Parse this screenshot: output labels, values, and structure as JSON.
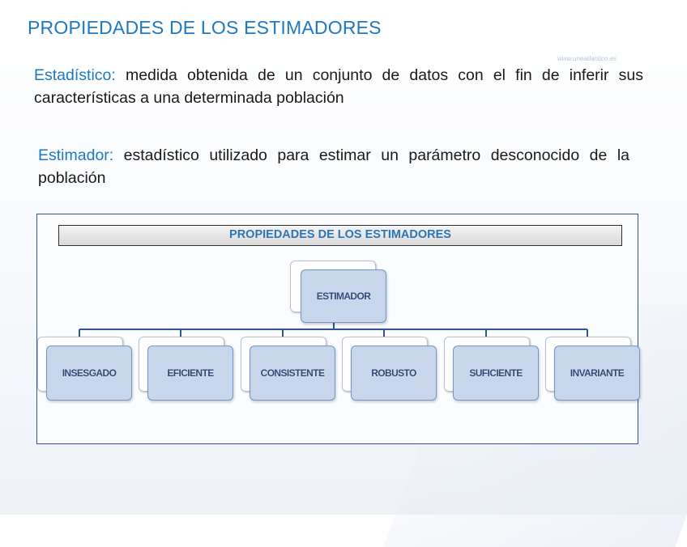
{
  "header": {
    "title": "PROPIEDADES DE LOS ESTIMADORES",
    "watermark": "www.uneatlantico.es"
  },
  "definitions": [
    {
      "term": "Estadístico:",
      "text": " medida obtenida de un conjunto de datos con el fin de inferir sus características a una determinada población"
    },
    {
      "term": "Estimador:",
      "text": " estadístico utilizado para estimar un parámetro desconocido de la población"
    }
  ],
  "diagram": {
    "banner": "PROPIEDADES DE LOS ESTIMADORES",
    "root": "ESTIMADOR",
    "children": [
      "INSESGADO",
      "EFICIENTE",
      "CONSISTENTE",
      "ROBUSTO",
      "SUFICIENTE",
      "INVARIANTE"
    ],
    "colors": {
      "node_fill": "#c8d6ec",
      "node_border": "#6f97cc",
      "connector": "#2f5597",
      "accent": "#1e78c2"
    }
  }
}
